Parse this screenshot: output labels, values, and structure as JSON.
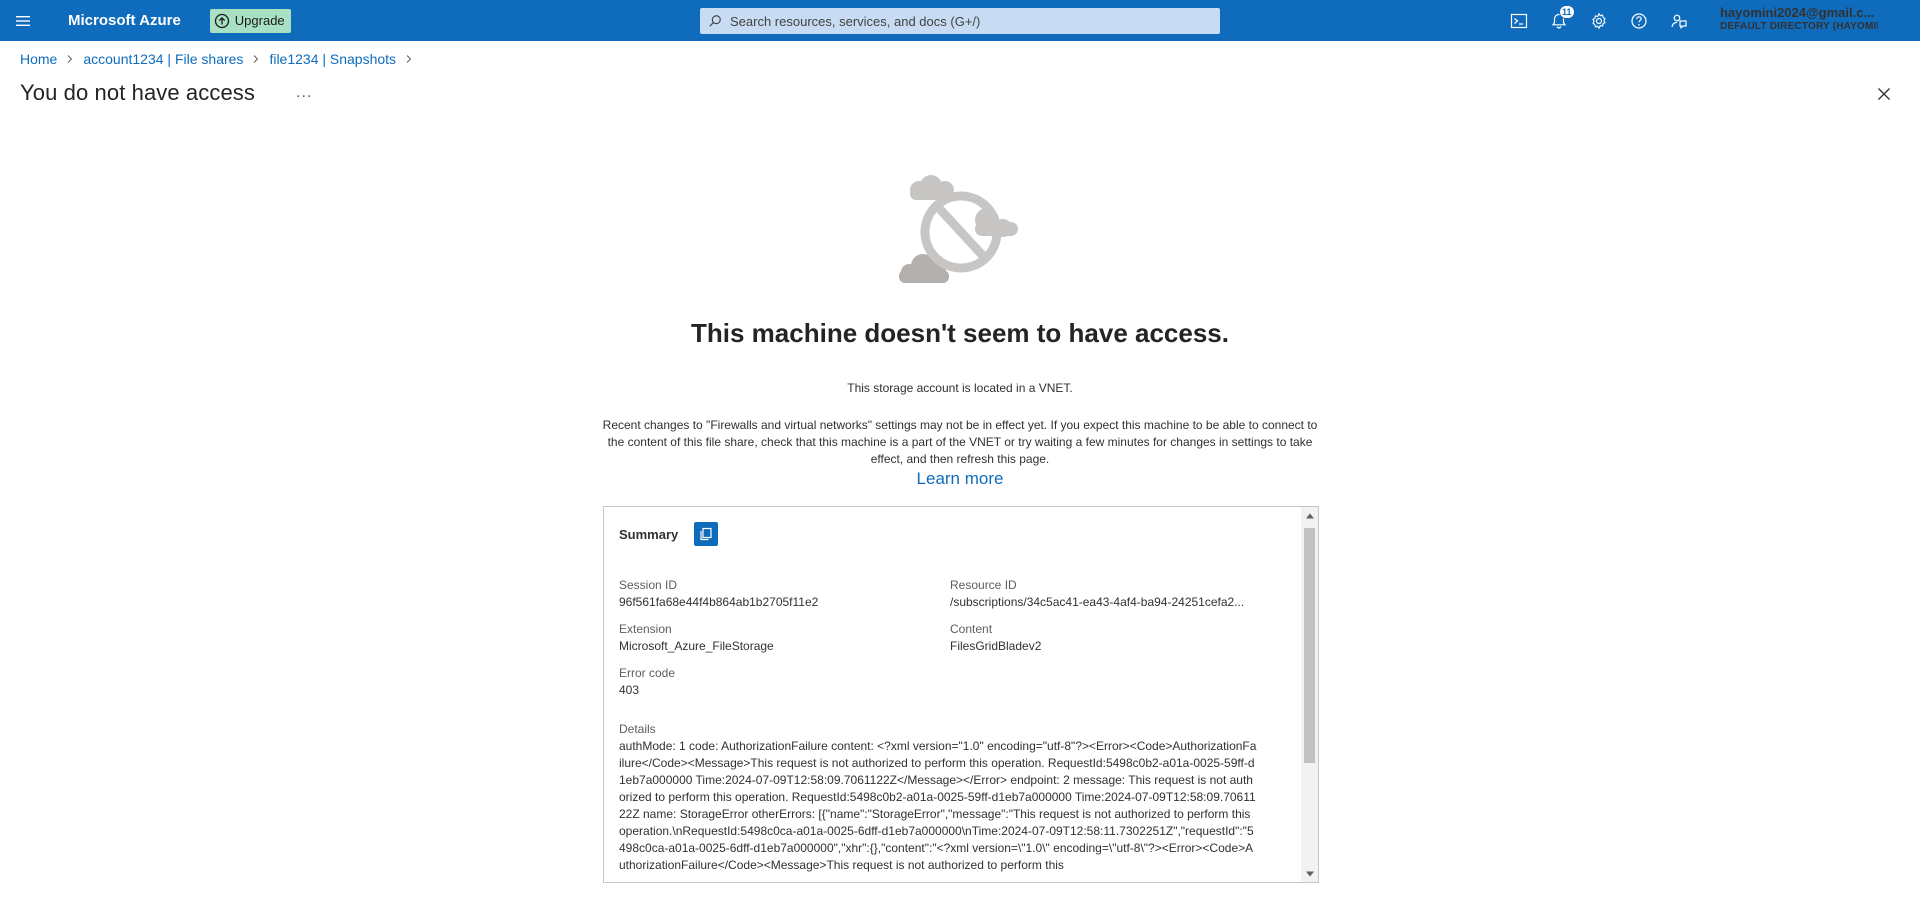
{
  "topbar": {
    "brand": "Microsoft Azure",
    "upgrade_label": "Upgrade",
    "search_placeholder": "Search resources, services, and docs (G+/)",
    "notification_count": "11",
    "account_email": "hayomini2024@gmail.c...",
    "account_directory": "DEFAULT DIRECTORY (HAYOMINI..."
  },
  "breadcrumb": {
    "items": [
      "Home",
      "account1234 | File shares",
      "file1234 | Snapshots"
    ]
  },
  "page": {
    "title": "You do not have access",
    "more_label": "...",
    "heading": "This machine doesn't seem to have access.",
    "subtext": "This storage account is located in a VNET.",
    "paragraph": "Recent changes to \"Firewalls and virtual networks\" settings may not be in effect yet. If you expect this machine to be able to connect to the content of this file share, check that this machine is a part of the VNET or try waiting a few minutes for changes in settings to take effect, and then refresh this page.",
    "learn_more": "Learn more"
  },
  "summary": {
    "title": "Summary",
    "session_id_label": "Session ID",
    "session_id": "96f561fa68e44f4b864ab1b2705f11e2",
    "resource_id_label": "Resource ID",
    "resource_id": "/subscriptions/34c5ac41-ea43-4af4-ba94-24251cefa2...",
    "extension_label": "Extension",
    "extension": "Microsoft_Azure_FileStorage",
    "content_label": "Content",
    "content": "FilesGridBladev2",
    "error_code_label": "Error code",
    "error_code": "403",
    "details_label": "Details",
    "details": "authMode: 1 code: AuthorizationFailure content: <?xml version=\"1.0\" encoding=\"utf-8\"?><Error><Code>AuthorizationFailure</Code><Message>This request is not authorized to perform this operation. RequestId:5498c0b2-a01a-0025-59ff-d1eb7a000000 Time:2024-07-09T12:58:09.7061122Z</Message></Error> endpoint: 2 message: This request is not authorized to perform this operation. RequestId:5498c0b2-a01a-0025-59ff-d1eb7a000000 Time:2024-07-09T12:58:09.7061122Z name: StorageError otherErrors: [{\"name\":\"StorageError\",\"message\":\"This request is not authorized to perform this operation.\\nRequestId:5498c0ca-a01a-0025-6dff-d1eb7a000000\\nTime:2024-07-09T12:58:11.7302251Z\",\"requestId\":\"5498c0ca-a01a-0025-6dff-d1eb7a000000\",\"xhr\":{},\"content\":\"<?xml version=\\\"1.0\\\" encoding=\\\"utf-8\\\"?><Error><Code>AuthorizationFailure</Code><Message>This request is not authorized to perform this"
  },
  "colors": {
    "topbar": "#0f6cbd",
    "upgrade": "#a8e0c4",
    "link": "#0f6cbd"
  },
  "icons": {
    "menu": "hamburger-icon",
    "search": "search-icon",
    "cloud_shell": "cloud-shell-icon",
    "notifications": "bell-icon",
    "settings": "gear-icon",
    "help": "help-icon",
    "feedback": "feedback-icon",
    "close": "close-icon",
    "copy": "copy-icon",
    "illustration": "no-access-cloud-icon"
  }
}
